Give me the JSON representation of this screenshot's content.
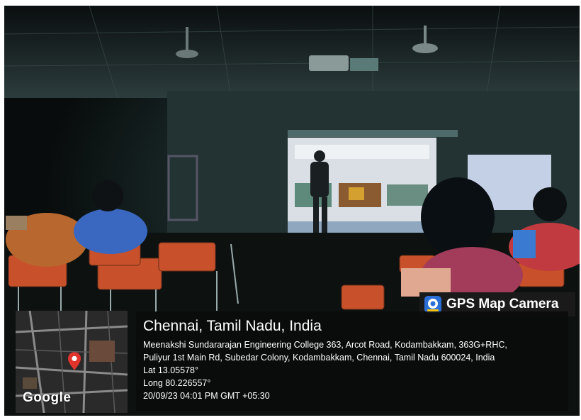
{
  "stamp": {
    "app_name": "GPS Map Camera",
    "map_provider": "Google",
    "city": "Chennai, Tamil Nadu, India",
    "address_line1": "Meenakshi Sundararajan Engineering College 363, Arcot Road, Kodambakkam, 363G+RHC,",
    "address_line2": "Puliyur 1st Main Rd, Subedar Colony, Kodambakkam, Chennai, Tamil Nadu 600024, India",
    "latitude": "Lat 13.05578°",
    "longitude": "Long 80.226557°",
    "timestamp": "20/09/23 04:01 PM GMT +05:30"
  },
  "colors": {
    "room_dark": "#0c1112",
    "screen_glow": "#d9dfe4",
    "chair_orange": "#c8502a",
    "stamp_bg": "#111111",
    "map_pin": "#e0342c"
  },
  "icons": {
    "app_icon": "gps-camera-icon",
    "map_marker": "map-pin-icon"
  }
}
